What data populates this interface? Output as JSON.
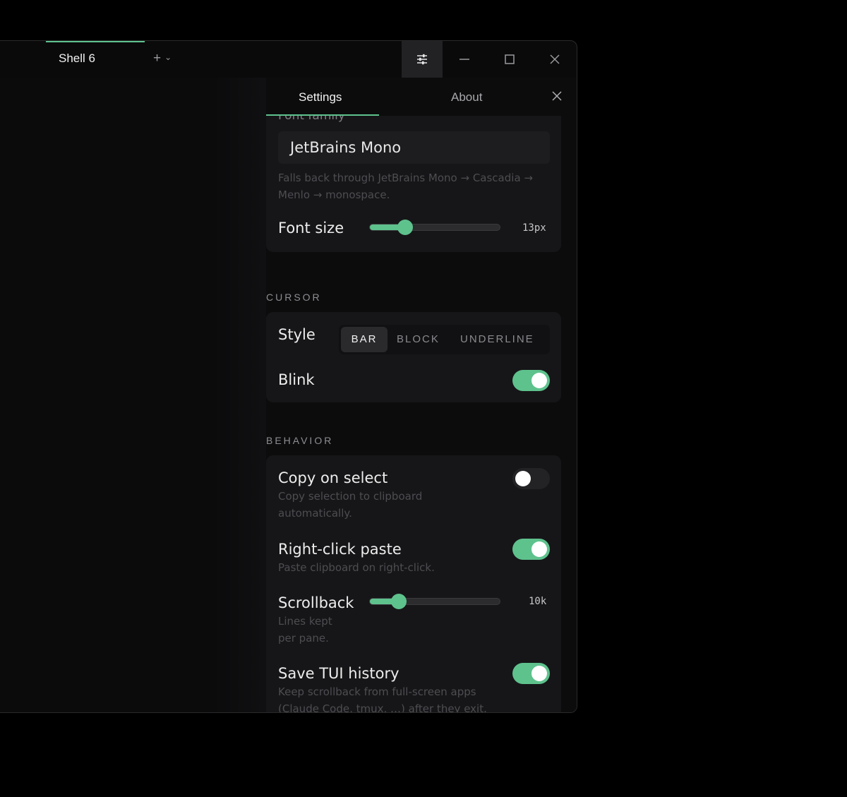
{
  "titlebar": {
    "tab_label": "Shell 6",
    "new_tab_plus": "+",
    "new_tab_chevron": "⌄",
    "icons": [
      "settings-sliders-icon",
      "minimize-icon",
      "maximize-icon",
      "close-icon"
    ]
  },
  "panel": {
    "tabs": {
      "settings": "Settings",
      "about": "About"
    },
    "font": {
      "family_label": "Font family",
      "family_value": "JetBrains Mono",
      "family_desc": "Falls back through JetBrains Mono → Cascadia → Menlo → monospace.",
      "size_label": "Font size",
      "size_value": "13px",
      "size_fraction": 0.27
    },
    "cursor": {
      "section": "CURSOR",
      "style_label": "Style",
      "styles": [
        "BAR",
        "BLOCK",
        "UNDERLINE"
      ],
      "selected_style": "BAR",
      "blink_label": "Blink",
      "blink_on": true
    },
    "behavior": {
      "section": "BEHAVIOR",
      "copy_label": "Copy on select",
      "copy_desc": "Copy selection to clipboard automatically.",
      "copy_on": false,
      "paste_label": "Right-click paste",
      "paste_desc": "Paste clipboard on right-click.",
      "paste_on": true,
      "scrollback_label": "Scrollback",
      "scrollback_desc": "Lines kept per pane.",
      "scrollback_value": "10k",
      "scrollback_fraction": 0.22,
      "tui_label": "Save TUI history",
      "tui_desc": "Keep scrollback from full-screen apps (Claude Code, tmux, …) after they exit.",
      "tui_on": true
    }
  },
  "colors": {
    "accent": "#5ec28d",
    "background": "#0a0a0b",
    "card": "#161618"
  }
}
